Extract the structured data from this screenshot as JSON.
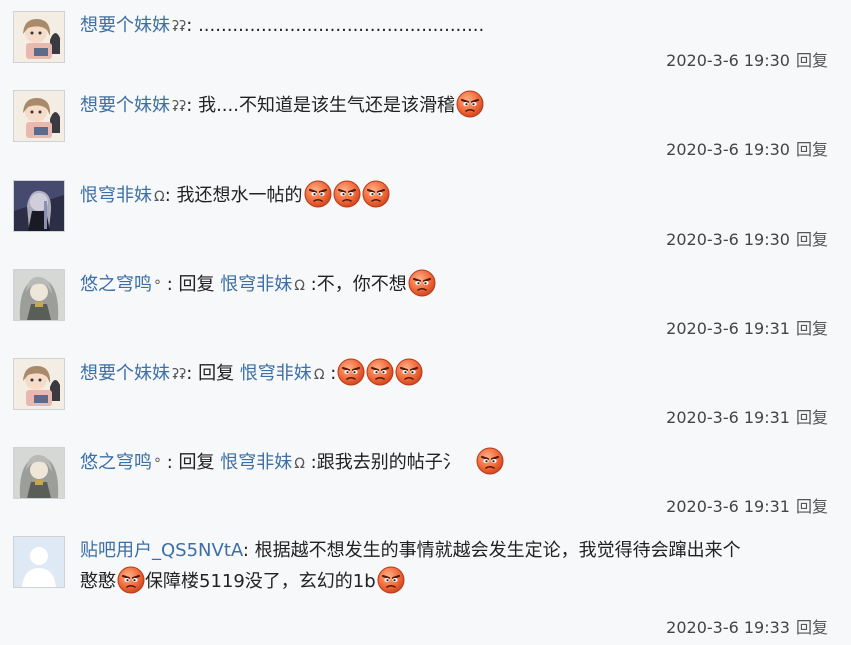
{
  "reply_label": "回复",
  "emoji_name": "angry-face",
  "avatar_blank_color": "#dfe8f5",
  "replies": [
    {
      "user": "想要个妹妹",
      "mark": "ʡʡ",
      "text": ": ..................................................",
      "timestamp": "2020-3-6 19:30"
    },
    {
      "user": "想要个妹妹",
      "mark": "ʡʡ",
      "text": ": 我....不知道是该生气还是该滑稽",
      "timestamp": "2020-3-6 19:30"
    },
    {
      "user": "恨穹非妹",
      "mark": "Ω",
      "text": ": 我还想水一帖的",
      "timestamp": "2020-3-6 19:30"
    },
    {
      "user": "悠之穹鸣",
      "mark": "°",
      "prefix": " : 回复 ",
      "mention": "恨穹非妹",
      "mention_mark": "Ω",
      "text": " :不，你不想",
      "timestamp": "2020-3-6 19:31"
    },
    {
      "user": "想要个妹妹",
      "mark": "ʡʡ",
      "prefix": ": 回复 ",
      "mention": "恨穹非妹",
      "mention_mark": "Ω",
      "text": " :",
      "timestamp": "2020-3-6 19:31"
    },
    {
      "user": "悠之穹鸣",
      "mark": "°",
      "prefix": " : 回复 ",
      "mention": "恨穹非妹",
      "mention_mark": "Ω",
      "text": " :跟我去别的帖子氵",
      "timestamp": "2020-3-6 19:31"
    },
    {
      "user": "贴吧用户_QS5NVtA",
      "text": ": 根据越不想发生的事情就越会发生定论，我觉得待会蹿出来个",
      "text2": "憨憨",
      "text3": "保障楼5119没了，玄幻的1b",
      "timestamp": "2020-3-6 19:33"
    }
  ]
}
